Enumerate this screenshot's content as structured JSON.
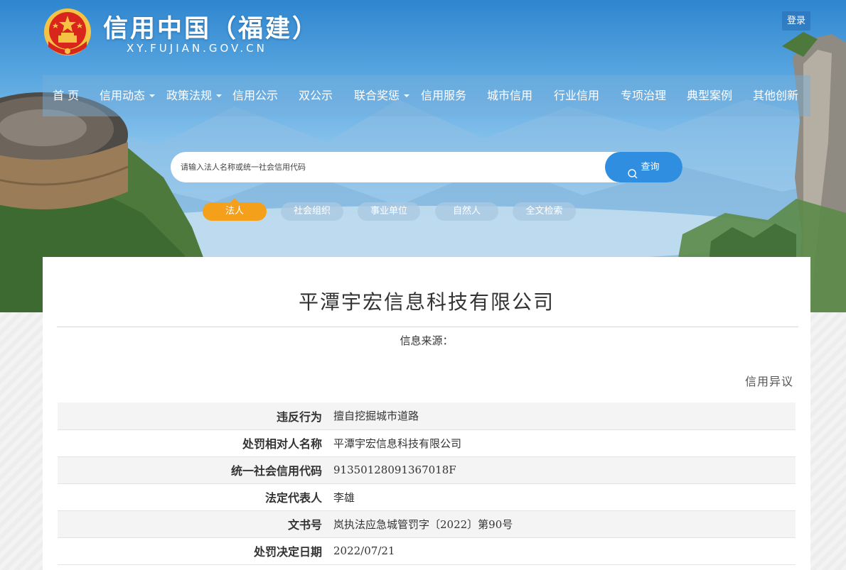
{
  "header": {
    "site_title": "信用中国（福建）",
    "site_url": "XY.FUJIAN.GOV.CN",
    "login_label": "登录"
  },
  "nav": {
    "items": [
      {
        "label": "首 页",
        "dropdown": false
      },
      {
        "label": "信用动态",
        "dropdown": true
      },
      {
        "label": "政策法规",
        "dropdown": true
      },
      {
        "label": "信用公示",
        "dropdown": false
      },
      {
        "label": "双公示",
        "dropdown": false
      },
      {
        "label": "联合奖惩",
        "dropdown": true
      },
      {
        "label": "信用服务",
        "dropdown": false
      },
      {
        "label": "城市信用",
        "dropdown": false
      },
      {
        "label": "行业信用",
        "dropdown": false
      },
      {
        "label": "专项治理",
        "dropdown": false
      },
      {
        "label": "典型案例",
        "dropdown": false
      },
      {
        "label": "其他创新",
        "dropdown": false
      }
    ]
  },
  "search": {
    "placeholder": "请输入法人名称或统一社会信用代码",
    "button_label": "查询"
  },
  "categories": {
    "items": [
      "法人",
      "社会组织",
      "事业单位",
      "自然人",
      "全文检索"
    ],
    "active": "法人"
  },
  "record": {
    "company_name": "平潭宇宏信息科技有限公司",
    "source_label": "信息来源：",
    "objection_label": "信用异议",
    "rows": [
      {
        "key": "违反行为",
        "value": "擅自挖掘城市道路"
      },
      {
        "key": "处罚相对人名称",
        "value": "平潭宇宏信息科技有限公司"
      },
      {
        "key": "统一社会信用代码",
        "value": "91350128091367018F"
      },
      {
        "key": "法定代表人",
        "value": "李雄"
      },
      {
        "key": "文书号",
        "value": "岚执法应急城管罚字〔2022〕第90号"
      },
      {
        "key": "处罚决定日期",
        "value": "2022/07/21"
      }
    ]
  },
  "colors": {
    "sky_top": "#2f86cf",
    "search_button": "#2f8ee0",
    "active_chip": "#f5a01a",
    "emblem_red": "#d8261c",
    "emblem_gold": "#f6c244"
  }
}
